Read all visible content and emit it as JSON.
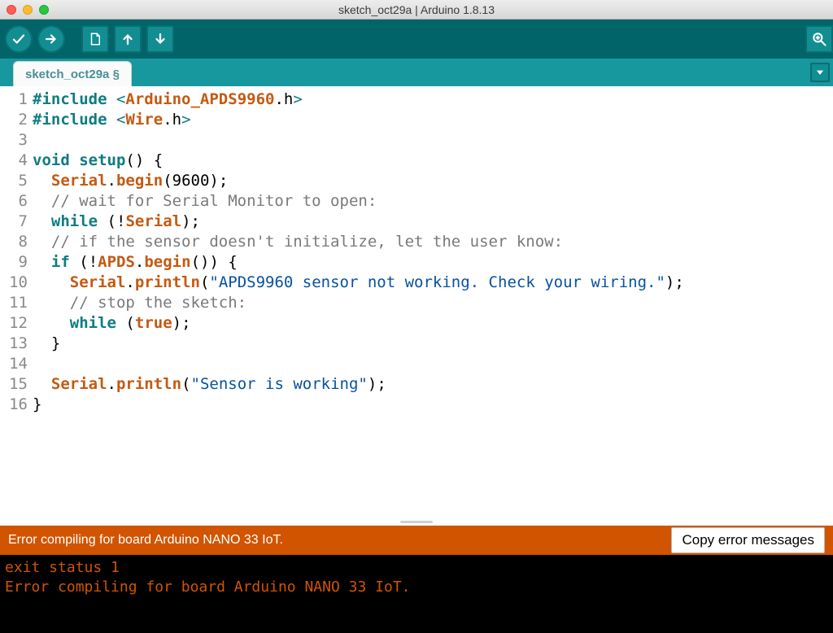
{
  "window": {
    "title": "sketch_oct29a | Arduino 1.8.13"
  },
  "tabs": {
    "active": "sketch_oct29a §"
  },
  "toolbar": {
    "verify": "Verify",
    "upload": "Upload",
    "new": "New",
    "open": "Open",
    "save": "Save",
    "serial": "Serial Monitor"
  },
  "code": {
    "lines": [
      {
        "n": "1"
      },
      {
        "n": "2"
      },
      {
        "n": "3"
      },
      {
        "n": "4"
      },
      {
        "n": "5"
      },
      {
        "n": "6"
      },
      {
        "n": "7"
      },
      {
        "n": "8"
      },
      {
        "n": "9"
      },
      {
        "n": "10"
      },
      {
        "n": "11"
      },
      {
        "n": "12"
      },
      {
        "n": "13"
      },
      {
        "n": "14"
      },
      {
        "n": "15"
      },
      {
        "n": "16"
      }
    ],
    "t": {
      "include": "#include",
      "lt": "<",
      "gt": ">",
      "lib_apds": "Arduino_APDS9960",
      "dot_h": ".h",
      "lib_wire": "Wire",
      "void": "void",
      "setup": "setup",
      "paren_pair": "()",
      "brace_l": "{",
      "brace_r": "}",
      "serial": "Serial",
      "dot": ".",
      "begin": "begin",
      "p_l": "(",
      "p_r": ")",
      "n9600": "9600",
      "semi": ";",
      "cmt_wait": "// wait for Serial Monitor to open:",
      "while": "while",
      "bang": "!",
      "cmt_init": "// if the sensor doesn't initialize, let the user know:",
      "if": "if",
      "apds": "APDS",
      "println": "println",
      "str_notworking": "\"APDS9960 sensor not working. Check your wiring.\"",
      "cmt_stop": "// stop the sketch:",
      "true": "true",
      "str_working": "\"Sensor is working\""
    }
  },
  "status": {
    "message": "Error compiling for board Arduino NANO 33 IoT.",
    "copy_label": "Copy error messages"
  },
  "console": {
    "line1": "exit status 1",
    "line2": "Error compiling for board Arduino NANO 33 IoT."
  },
  "colors": {
    "teal_dark": "#006468",
    "teal": "#17989e",
    "teal_btn": "#128e92",
    "orange": "#d15400",
    "keyword": "#0f7c81",
    "lib": "#c35a12",
    "string": "#0652a0",
    "comment": "#7a7a7a"
  }
}
